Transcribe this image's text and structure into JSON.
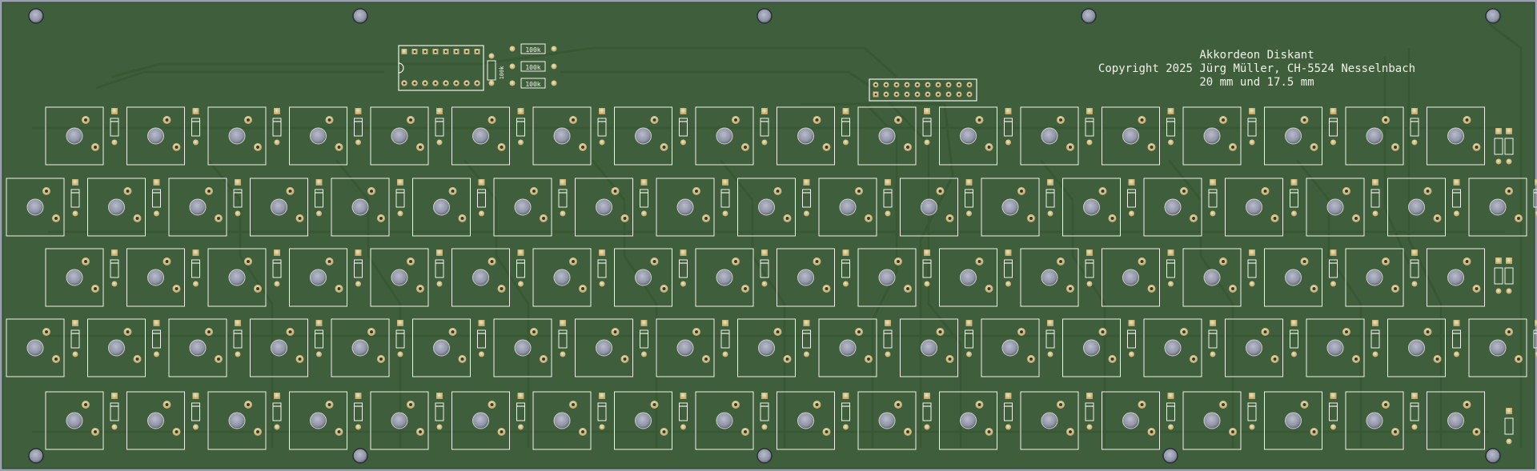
{
  "viewer": {
    "view": "pcb-3d-render",
    "board_color": "#3f5e3b",
    "silkscreen_color": "#f2f2ea",
    "copper_color": "#d9c58a"
  },
  "silkscreen": {
    "title": "Akkordeon Diskant",
    "copyright": "Copyright 2025 Jürg Müller, CH-5524 Nesselnbach",
    "sizes": "20 mm und 17.5 mm"
  },
  "components": {
    "resistor_values": [
      "100k",
      "100k",
      "100k"
    ],
    "resistor_rotated_label": "100k",
    "ic_pins_per_side": 8,
    "header_pins_per_row": 10,
    "header_rows": 2
  },
  "key_grid": {
    "rows": [
      {
        "keys": 18,
        "offset": "full"
      },
      {
        "keys": 19,
        "offset": "half"
      },
      {
        "keys": 18,
        "offset": "full"
      },
      {
        "keys": 19,
        "offset": "half"
      },
      {
        "keys": 18,
        "offset": "full"
      }
    ]
  }
}
